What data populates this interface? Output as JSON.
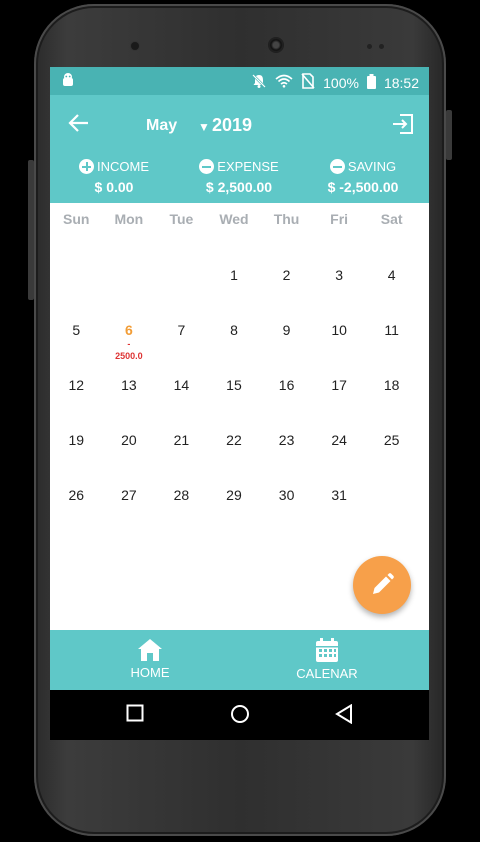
{
  "status": {
    "battery": "100%",
    "time": "18:52"
  },
  "header": {
    "month": "May",
    "year": "2019"
  },
  "summary": {
    "income_label": "INCOME",
    "income_value": "$ 0.00",
    "expense_label": "EXPENSE",
    "expense_value": "$ 2,500.00",
    "saving_label": "SAVING",
    "saving_value": "$ -2,500.00"
  },
  "weekdays": [
    "Sun",
    "Mon",
    "Tue",
    "Wed",
    "Thu",
    "Fri",
    "Sat"
  ],
  "days": [
    {
      "day": "1",
      "note": ""
    },
    {
      "day": "2",
      "note": ""
    },
    {
      "day": "3",
      "note": ""
    },
    {
      "day": "4",
      "note": ""
    },
    {
      "day": "5",
      "note": ""
    },
    {
      "day": "6",
      "note": "- 2500.0"
    },
    {
      "day": "7",
      "note": ""
    },
    {
      "day": "8",
      "note": ""
    },
    {
      "day": "9",
      "note": ""
    },
    {
      "day": "10",
      "note": ""
    },
    {
      "day": "11",
      "note": ""
    },
    {
      "day": "12",
      "note": ""
    },
    {
      "day": "13",
      "note": ""
    },
    {
      "day": "14",
      "note": ""
    },
    {
      "day": "15",
      "note": ""
    },
    {
      "day": "16",
      "note": ""
    },
    {
      "day": "17",
      "note": ""
    },
    {
      "day": "18",
      "note": ""
    },
    {
      "day": "19",
      "note": ""
    },
    {
      "day": "20",
      "note": ""
    },
    {
      "day": "21",
      "note": ""
    },
    {
      "day": "22",
      "note": ""
    },
    {
      "day": "23",
      "note": ""
    },
    {
      "day": "24",
      "note": ""
    },
    {
      "day": "25",
      "note": ""
    },
    {
      "day": "26",
      "note": ""
    },
    {
      "day": "27",
      "note": ""
    },
    {
      "day": "28",
      "note": ""
    },
    {
      "day": "29",
      "note": ""
    },
    {
      "day": "30",
      "note": ""
    },
    {
      "day": "31",
      "note": ""
    }
  ],
  "note_dash": "-",
  "note_amount": "2500.0",
  "nav": {
    "home_label": "HOME",
    "calendar_label": "CALENAR"
  },
  "colors": {
    "primary": "#5fc8c8",
    "status_bar": "#49b3b3",
    "fab": "#f7a04a",
    "today": "#f29d37",
    "expense_note": "#dd3333"
  },
  "icons": [
    "android-debug-icon",
    "bell-off-icon",
    "wifi-icon",
    "no-sim-icon",
    "battery-icon",
    "back-arrow-icon",
    "exit-icon",
    "plus-circle-icon",
    "minus-circle-icon",
    "pencil-icon",
    "home-icon",
    "calendar-icon",
    "nav-square-icon",
    "nav-circle-icon",
    "nav-triangle-icon"
  ]
}
